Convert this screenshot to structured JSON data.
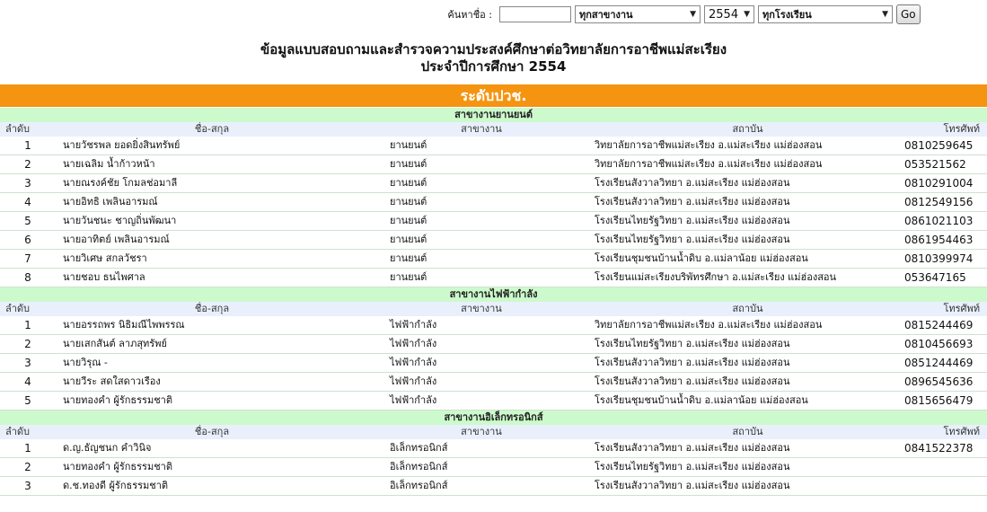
{
  "search": {
    "label": "ค้นหาชื่อ :",
    "input_value": "",
    "dept_selected": "ทุกสาขางาน",
    "year_selected": "2554",
    "school_selected": "ทุกโรงเรียน",
    "go_label": "Go"
  },
  "title": {
    "line1": "ข้อมูลแบบสอบถามและสำรวจความประสงค์ศึกษาต่อวิทยาลัยการอาชีพแม่สะเรียง",
    "line2": "ประจำปีการศึกษา 2554"
  },
  "level": "ระดับปวช.",
  "columns": {
    "no": "ลำดับ",
    "name": "ชื่อ-สกุล",
    "dept": "สาขางาน",
    "inst": "สถาบัน",
    "tel": "โทรศัพท์"
  },
  "groups": [
    {
      "title": "สาขางานยานยนต์",
      "rows": [
        {
          "no": "1",
          "name": "นายวัชรพล ยอดยิ่งสินทรัพย์",
          "dept": "ยานยนต์",
          "inst": "วิทยาลัยการอาชีพแม่สะเรียง อ.แม่สะเรียง แม่ฮ่องสอน",
          "tel": "0810259645"
        },
        {
          "no": "2",
          "name": "นายเฉลิม น้ำก้าวหน้า",
          "dept": "ยานยนต์",
          "inst": "วิทยาลัยการอาชีพแม่สะเรียง อ.แม่สะเรียง แม่ฮ่องสอน",
          "tel": "053521562"
        },
        {
          "no": "3",
          "name": "นายณรงค์ชัย โกมลช่อมาลี",
          "dept": "ยานยนต์",
          "inst": "โรงเรียนสังวาลวิทยา อ.แม่สะเรียง แม่ฮ่องสอน",
          "tel": "0810291004"
        },
        {
          "no": "4",
          "name": "นายอิทธิ เพลินอารมณ์",
          "dept": "ยานยนต์",
          "inst": "โรงเรียนสังวาลวิทยา อ.แม่สะเรียง แม่ฮ่องสอน",
          "tel": "0812549156"
        },
        {
          "no": "5",
          "name": "นายวันชนะ ชาญถิ่นพัฒนา",
          "dept": "ยานยนต์",
          "inst": "โรงเรียนไทยรัฐวิทยา อ.แม่สะเรียง แม่ฮ่องสอน",
          "tel": "0861021103"
        },
        {
          "no": "6",
          "name": "นายอาทิตย์ เพลินอารมณ์",
          "dept": "ยานยนต์",
          "inst": "โรงเรียนไทยรัฐวิทยา อ.แม่สะเรียง แม่ฮ่องสอน",
          "tel": "0861954463"
        },
        {
          "no": "7",
          "name": "นายวิเศษ สกลวัชรา",
          "dept": "ยานยนต์",
          "inst": "โรงเรียนชุมชนบ้านน้ำดิบ อ.แม่ลาน้อย แม่ฮ่องสอน",
          "tel": "0810399974"
        },
        {
          "no": "8",
          "name": "นายชอบ ธนไพศาล",
          "dept": "ยานยนต์",
          "inst": "โรงเรียนแม่สะเรียงบริพัทรศึกษา อ.แม่สะเรียง แม่ฮ่องสอน",
          "tel": "053647165"
        }
      ]
    },
    {
      "title": "สาขางานไฟฟ้ากำลัง",
      "rows": [
        {
          "no": "1",
          "name": "นายอรรถพร นิธิมณีไพพรรณ",
          "dept": "ไฟฟ้ากำลัง",
          "inst": "วิทยาลัยการอาชีพแม่สะเรียง อ.แม่สะเรียง แม่ฮ่องสอน",
          "tel": "0815244469"
        },
        {
          "no": "2",
          "name": "นายเสกสันต์ ลาภสุทรัพย์",
          "dept": "ไฟฟ้ากำลัง",
          "inst": "โรงเรียนไทยรัฐวิทยา อ.แม่สะเรียง แม่ฮ่องสอน",
          "tel": "0810456693"
        },
        {
          "no": "3",
          "name": "นายวิรุณ -",
          "dept": "ไฟฟ้ากำลัง",
          "inst": "โรงเรียนสังวาลวิทยา อ.แม่สะเรียง แม่ฮ่องสอน",
          "tel": "0851244469"
        },
        {
          "no": "4",
          "name": "นายวีระ สดใสดาวเรือง",
          "dept": "ไฟฟ้ากำลัง",
          "inst": "โรงเรียนสังวาลวิทยา อ.แม่สะเรียง แม่ฮ่องสอน",
          "tel": "0896545636"
        },
        {
          "no": "5",
          "name": "นายทองคำ ผู้รักธรรมชาติ",
          "dept": "ไฟฟ้ากำลัง",
          "inst": "โรงเรียนชุมชนบ้านน้ำดิบ อ.แม่ลาน้อย แม่ฮ่องสอน",
          "tel": "0815656479"
        }
      ]
    },
    {
      "title": "สาขางานอิเล็กทรอนิกส์",
      "rows": [
        {
          "no": "1",
          "name": "ด.ญ.ธัญชนก คำวินิจ",
          "dept": "อิเล็กทรอนิกส์",
          "inst": "โรงเรียนสังวาลวิทยา อ.แม่สะเรียง แม่ฮ่องสอน",
          "tel": "0841522378"
        },
        {
          "no": "2",
          "name": "นายทองคำ ผู้รักธรรมชาติ",
          "dept": "อิเล็กทรอนิกส์",
          "inst": "โรงเรียนไทยรัฐวิทยา อ.แม่สะเรียง แม่ฮ่องสอน",
          "tel": ""
        },
        {
          "no": "3",
          "name": "ด.ช.ทองดี ผู้รักธรรมชาติ",
          "dept": "อิเล็กทรอนิกส์",
          "inst": "โรงเรียนสังวาลวิทยา อ.แม่สะเรียง แม่ฮ่องสอน",
          "tel": ""
        }
      ]
    }
  ],
  "icons": {
    "dropdown": "triangle-down"
  }
}
